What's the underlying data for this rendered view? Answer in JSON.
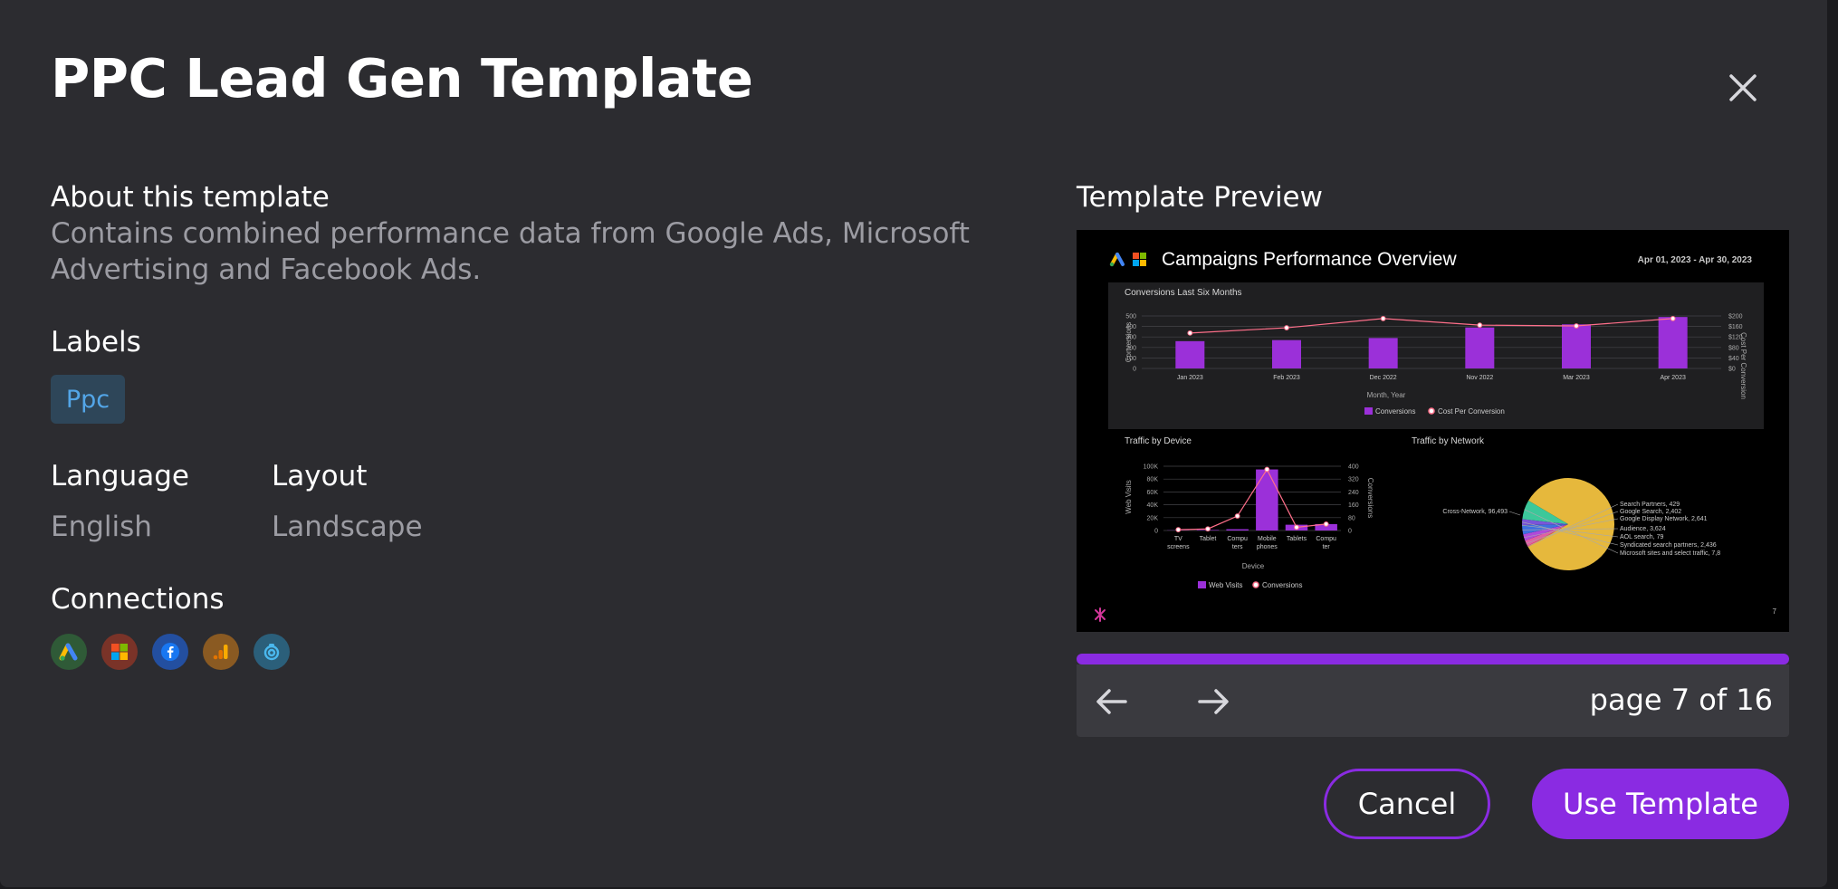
{
  "modal": {
    "title": "PPC Lead Gen Template",
    "close_label": "×"
  },
  "about": {
    "heading": "About this template",
    "line1": "Contains combined performance data from Google Ads, Microsoft",
    "line2": "Advertising and Facebook Ads."
  },
  "labels": {
    "heading": "Labels",
    "items": [
      "Ppc"
    ]
  },
  "language": {
    "heading": "Language",
    "value": "English"
  },
  "layout": {
    "heading": "Layout",
    "value": "Landscape"
  },
  "connections": {
    "heading": "Connections",
    "icons": [
      {
        "name": "google-ads-icon",
        "bg": "#2f5a37"
      },
      {
        "name": "microsoft-icon",
        "bg": "#7a3328"
      },
      {
        "name": "facebook-icon",
        "bg": "#234fa0"
      },
      {
        "name": "google-analytics-icon",
        "bg": "#8a5a22"
      },
      {
        "name": "connection-icon",
        "bg": "#2b5f7a"
      }
    ]
  },
  "preview": {
    "heading": "Template Preview",
    "report_title": "Campaigns Performance Overview",
    "date_range": "Apr 01, 2023 - Apr 30, 2023",
    "page_number": "7",
    "progress_fraction": 1.0,
    "page_indicator": "page 7 of 16",
    "charts": {
      "conversions": {
        "title": "Conversions Last Six Months",
        "xlabel": "Month, Year",
        "ylabel_left": "Conversions",
        "ylabel_right": "Cost Per Conversion",
        "categories": [
          "Jan 2023",
          "Feb 2023",
          "Dec 2022",
          "Nov 2022",
          "Mar 2023",
          "Apr 2023"
        ],
        "left_ticks": [
          "500",
          "400",
          "300",
          "200",
          "100",
          "0"
        ],
        "right_ticks": [
          "$200",
          "$160",
          "$120",
          "$80",
          "$40",
          "$0"
        ],
        "legend": [
          "Conversions",
          "Cost Per Conversion"
        ]
      },
      "device": {
        "title": "Traffic by Device",
        "xlabel": "Device",
        "ylabel_left": "Web Visits",
        "ylabel_right": "Conversions",
        "categories": [
          "TV screens",
          "Tablet",
          "Computers",
          "Mobile phones",
          "Tablets",
          "Computer"
        ],
        "left_ticks": [
          "100K",
          "80K",
          "60K",
          "40K",
          "20K",
          "0"
        ],
        "right_ticks": [
          "400",
          "320",
          "240",
          "160",
          "80",
          "0"
        ],
        "legend": [
          "Web Visits",
          "Conversions"
        ]
      },
      "network": {
        "title": "Traffic by Network",
        "slices": [
          "Cross-Network, 96,493",
          "Search Partners, 429",
          "Google Search, 2,402",
          "Google Display Network, 2,641",
          "Audience, 3,624",
          "AOL search, 79",
          "Syndicated search partners, 2,436",
          "Microsoft sites and select traffic, 7,8"
        ]
      }
    }
  },
  "footer": {
    "cancel_label": "Cancel",
    "use_label": "Use Template"
  },
  "colors": {
    "accent": "#8a2be2",
    "chip_text": "#53a6e8",
    "pie_main": "#e6b83c"
  },
  "chart_data": [
    {
      "type": "bar",
      "title": "Conversions Last Six Months",
      "xlabel": "Month, Year",
      "ylabel": "Conversions",
      "categories": [
        "Jan 2023",
        "Feb 2023",
        "Dec 2022",
        "Nov 2022",
        "Mar 2023",
        "Apr 2023"
      ],
      "ylim": [
        0,
        500
      ],
      "y2lim": [
        0,
        200
      ],
      "series": [
        {
          "name": "Conversions",
          "type": "bar",
          "values": [
            260,
            270,
            290,
            390,
            420,
            490
          ]
        },
        {
          "name": "Cost Per Conversion",
          "type": "line",
          "axis": "right",
          "values": [
            135,
            155,
            190,
            165,
            162,
            190
          ]
        }
      ]
    },
    {
      "type": "bar",
      "title": "Traffic by Device",
      "xlabel": "Device",
      "ylabel": "Web Visits",
      "categories": [
        "TV screens",
        "Tablet",
        "Computers",
        "Mobile phones",
        "Tablets",
        "Computer"
      ],
      "ylim": [
        0,
        100000
      ],
      "y2lim": [
        0,
        400
      ],
      "series": [
        {
          "name": "Web Visits",
          "type": "bar",
          "values": [
            300,
            800,
            2000,
            95000,
            9000,
            10000
          ]
        },
        {
          "name": "Conversions",
          "type": "line",
          "axis": "right",
          "values": [
            5,
            10,
            90,
            380,
            20,
            40
          ]
        }
      ]
    },
    {
      "type": "pie",
      "title": "Traffic by Network",
      "labels": [
        "Cross-Network",
        "Search Partners",
        "Google Search",
        "Google Display Network",
        "Audience",
        "AOL search",
        "Syndicated search partners",
        "Microsoft sites and select traffic"
      ],
      "values": [
        96493,
        429,
        2402,
        2641,
        3624,
        79,
        2436,
        7800
      ],
      "colors": [
        "#e6b83c",
        "#ff6f61",
        "#e05fa3",
        "#b04ad9",
        "#3f6fe0",
        "#4aa0e8",
        "#7b55d9",
        "#3cc89a"
      ]
    }
  ]
}
